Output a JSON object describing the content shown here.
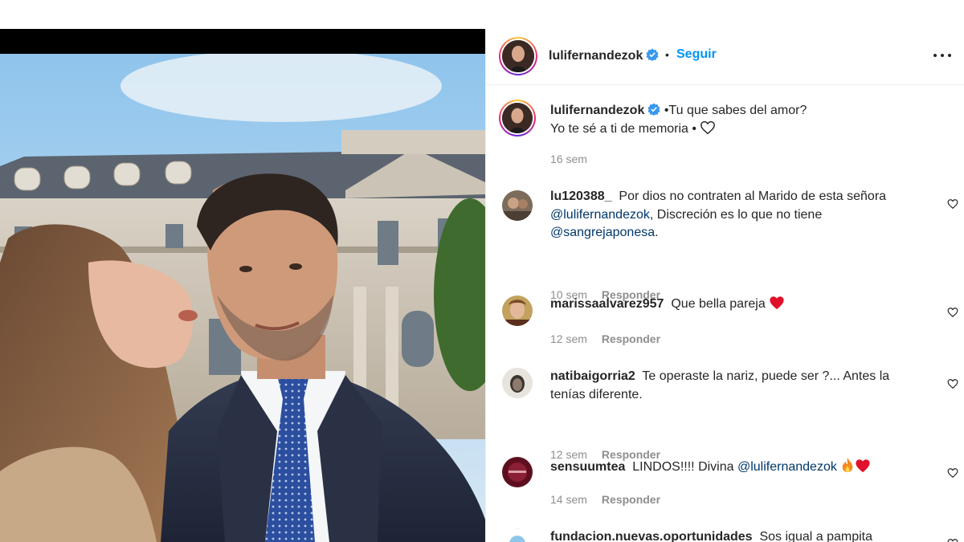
{
  "post": {
    "username": "lulifernandezok",
    "verified": true,
    "separator": "•",
    "follow_label": "Seguir",
    "caption_line1": "•Tu que sabes del amor?",
    "caption_line2": "Yo te sé a ti de memoria •",
    "caption_time": "16 sem"
  },
  "comments": [
    {
      "username": "lu120388_",
      "text_a": "Por dios no contraten al Marido de esta señora",
      "mention_a": "@lulifernandezok",
      "text_b": ", Discreción es lo que no tiene",
      "mention_b": "@sangrejaponesa",
      "text_c": ".",
      "time": "10 sem",
      "reply_label": "Responder"
    },
    {
      "username": "marissaalvarez957",
      "text_a": "Que bella pareja",
      "emoji": "red-heart",
      "time": "12 sem",
      "reply_label": "Responder"
    },
    {
      "username": "natibaigorria2",
      "text_a": "Te operaste la nariz, puede ser ?... Antes la tenías diferente.",
      "time": "12 sem",
      "reply_label": "Responder"
    },
    {
      "username": "sensuumtea",
      "text_a": "LINDOS!!!! Divina",
      "mention_a": "@lulifernandezok",
      "emoji": "fire red-heart",
      "time": "14 sem",
      "reply_label": "Responder"
    },
    {
      "username": "fundacion.nuevas.oportunidades",
      "text_a": "Sos igual a pampita"
    }
  ],
  "colors": {
    "link_blue": "#0095f6",
    "mention_blue": "#00376b",
    "muted_gray": "#8e8e8e",
    "heart_red": "#ed4956",
    "verified_blue": "#3897f0"
  },
  "icons": [
    "verified-badge-icon",
    "more-options-icon",
    "outline-heart-icon",
    "like-heart-icon",
    "red-heart-emoji",
    "fire-emoji"
  ]
}
